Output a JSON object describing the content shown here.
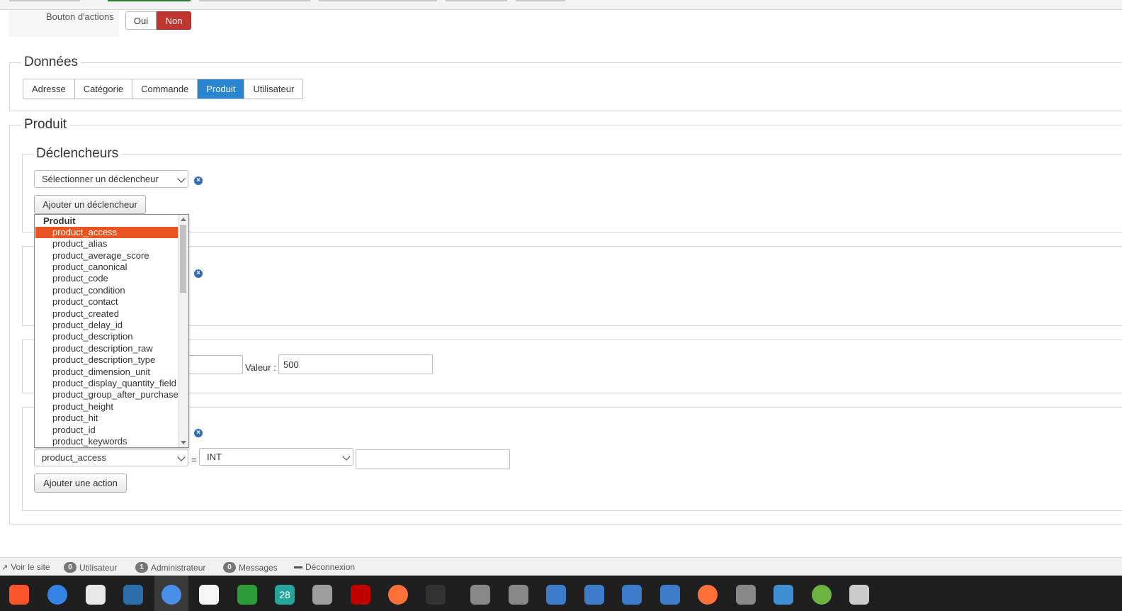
{
  "options": {
    "actions_label": "Bouton d'actions",
    "yes": "Oui",
    "no": "Non"
  },
  "donnees": {
    "legend": "Données",
    "tabs": [
      {
        "label": "Adresse",
        "active": false
      },
      {
        "label": "Catégorie",
        "active": false
      },
      {
        "label": "Commande",
        "active": false
      },
      {
        "label": "Produit",
        "active": true
      },
      {
        "label": "Utilisateur",
        "active": false
      }
    ]
  },
  "produit": {
    "legend": "Produit",
    "triggers": {
      "legend": "Déclencheurs",
      "select_placeholder": "Sélectionner un déclencheur",
      "add_button": "Ajouter un déclencheur"
    },
    "filter": {
      "value_label": "Valeur :",
      "value": "500"
    },
    "actions": {
      "field_select": "product_access",
      "operator": "=",
      "type_select": "INT",
      "value": "",
      "add_button": "Ajouter une action"
    }
  },
  "dropdown": {
    "group": "Produit",
    "selected": "product_access",
    "items": [
      "product_access",
      "product_alias",
      "product_average_score",
      "product_canonical",
      "product_code",
      "product_condition",
      "product_contact",
      "product_created",
      "product_delay_id",
      "product_description",
      "product_description_raw",
      "product_description_type",
      "product_dimension_unit",
      "product_display_quantity_field",
      "product_group_after_purchase",
      "product_height",
      "product_hit",
      "product_id",
      "product_keywords"
    ]
  },
  "statusbar": {
    "view_site": "Voir le site",
    "users_count": "0",
    "users_label": "Utilisateur",
    "admins_count": "1",
    "admins_label": "Administrateur",
    "messages_count": "0",
    "messages_label": "Messages",
    "logout": "Déconnexion"
  },
  "taskbar": {
    "apps": [
      {
        "icon": "brave-icon",
        "color": "#fb542b"
      },
      {
        "icon": "help-icon",
        "color": "#3584e4"
      },
      {
        "icon": "software-center-icon",
        "color": "#e8e8e8"
      },
      {
        "icon": "screenshot-app-icon",
        "color": "#2c6fa8"
      },
      {
        "icon": "chromium-icon",
        "color": "#4a8fe7"
      },
      {
        "icon": "text-editor-icon",
        "color": "#f5f5f5"
      },
      {
        "icon": "spreadsheet-icon",
        "color": "#2e9b3a"
      },
      {
        "icon": "calendar-icon",
        "color": "#26a69a",
        "text": "28"
      },
      {
        "icon": "files-icon",
        "color": "#9e9e9e"
      },
      {
        "icon": "filezilla-icon",
        "color": "#bf0000"
      },
      {
        "icon": "firefox-icon",
        "color": "#ff7139"
      },
      {
        "icon": "system-monitor-icon",
        "color": "#333333"
      },
      {
        "icon": "settings-icon",
        "color": "#888888"
      },
      {
        "icon": "settings-icon",
        "color": "#888888"
      },
      {
        "icon": "mail-icon",
        "color": "#3d7cc9"
      },
      {
        "icon": "mail-icon",
        "color": "#3d7cc9"
      },
      {
        "icon": "mail-icon",
        "color": "#3d7cc9"
      },
      {
        "icon": "mail-icon",
        "color": "#3d7cc9"
      },
      {
        "icon": "firefox-icon",
        "color": "#ff7139"
      },
      {
        "icon": "settings-icon",
        "color": "#888888"
      },
      {
        "icon": "atom-icon",
        "color": "#3f8fd2"
      },
      {
        "icon": "keepass-icon",
        "color": "#6cb33f"
      },
      {
        "icon": "trash-icon",
        "color": "#cccccc"
      }
    ]
  }
}
